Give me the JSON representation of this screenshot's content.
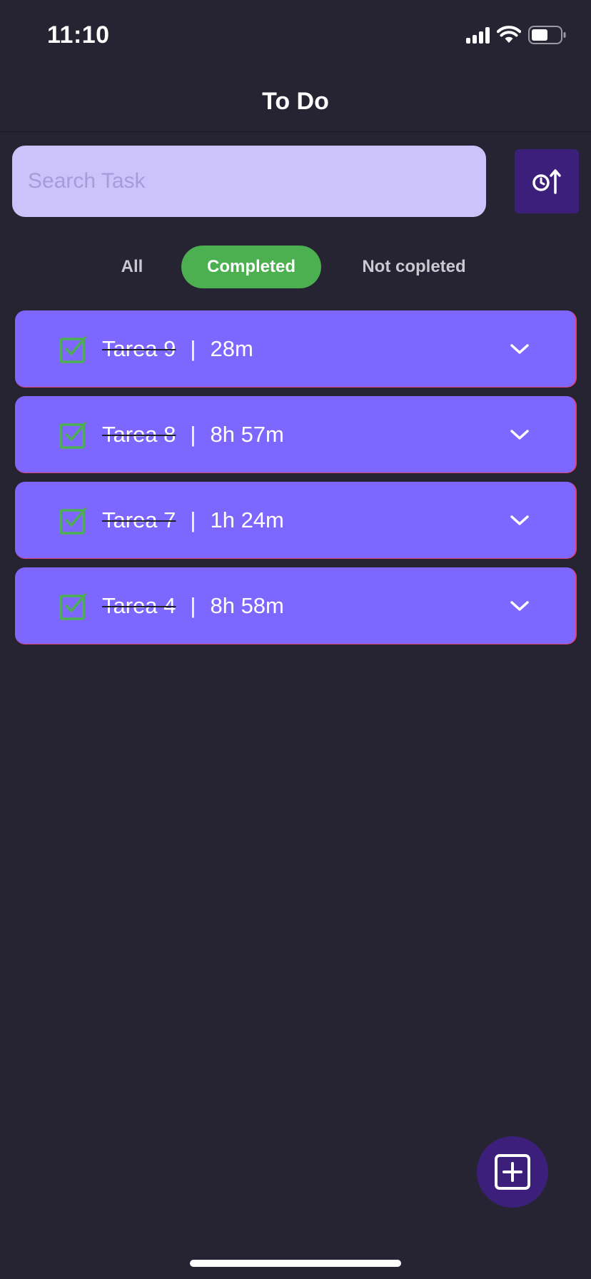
{
  "status_bar": {
    "time": "11:10",
    "signal_icon": "cellular-signal-icon",
    "wifi_icon": "wifi-icon",
    "battery_icon": "battery-icon",
    "battery_level": 0.5
  },
  "header": {
    "title": "To Do"
  },
  "search": {
    "placeholder": "Search Task",
    "value": ""
  },
  "sort_button": {
    "icon": "clock-sort-ascending-icon"
  },
  "filters": {
    "all_label": "All",
    "completed_label": "Completed",
    "not_completed_label": "Not copleted",
    "selected": "Completed"
  },
  "tasks": [
    {
      "name": "Tarea 9",
      "separator": "|",
      "duration": "28m",
      "completed": true
    },
    {
      "name": "Tarea 8",
      "separator": "|",
      "duration": "8h 57m",
      "completed": true
    },
    {
      "name": "Tarea 7",
      "separator": "|",
      "duration": "1h 24m",
      "completed": true
    },
    {
      "name": "Tarea 4",
      "separator": "|",
      "duration": "8h 58m",
      "completed": true
    }
  ],
  "fab": {
    "icon": "add-square-icon"
  },
  "colors": {
    "background": "#262433",
    "card": "#7d67fe",
    "search_bg": "#cdc3fb",
    "accent_dark": "#3b1f7a",
    "active_tab": "#4caf50",
    "check": "#4caf50"
  }
}
